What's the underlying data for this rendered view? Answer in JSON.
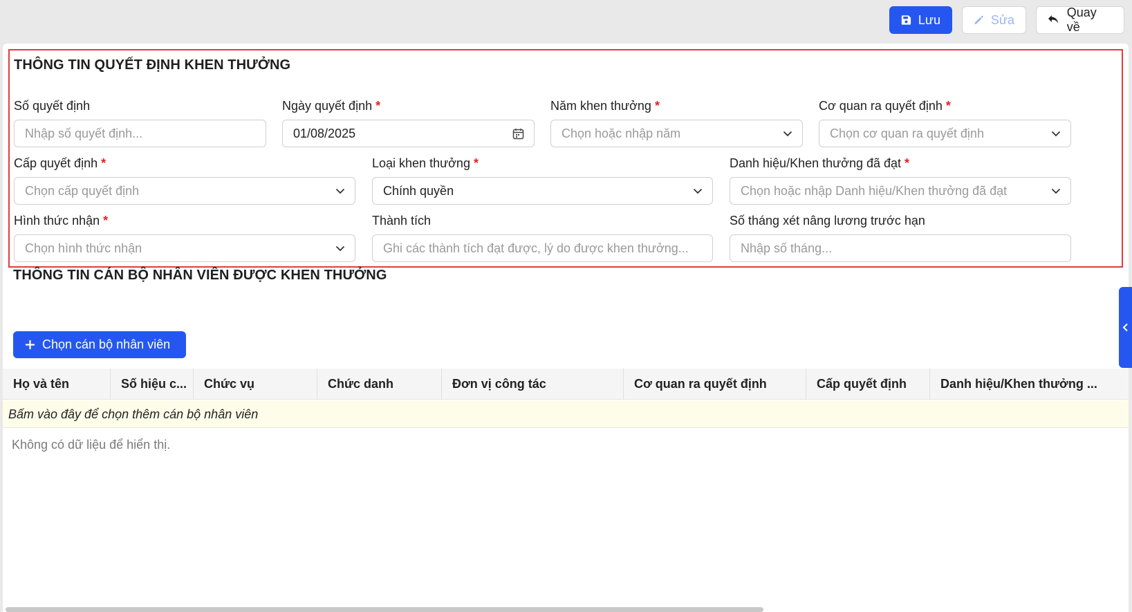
{
  "toolbar": {
    "save_label": "Lưu",
    "edit_label": "Sửa",
    "back_label": "Quay về"
  },
  "decision_section": {
    "title": "THÔNG TIN QUYẾT ĐỊNH KHEN THƯỞNG",
    "fields": {
      "so_quyet_dinh": {
        "label": "Số quyết định",
        "placeholder": "Nhập số quyết định..."
      },
      "ngay_quyet_dinh": {
        "label": "Ngày quyết định",
        "value": "01/08/2025"
      },
      "nam_khen_thuong": {
        "label": "Năm khen thưởng",
        "placeholder": "Chọn hoặc nhập năm"
      },
      "co_quan": {
        "label": "Cơ quan ra quyết định",
        "placeholder": "Chọn cơ quan ra quyết định"
      },
      "cap_quyet_dinh": {
        "label": "Cấp quyết định",
        "placeholder": "Chọn cấp quyết định"
      },
      "loai_khen_thuong": {
        "label": "Loại khen thưởng",
        "value": "Chính quyền"
      },
      "danh_hieu": {
        "label": "Danh hiệu/Khen thưởng đã đạt",
        "placeholder": "Chọn hoặc nhập Danh hiệu/Khen thưởng đã đạt"
      },
      "hinh_thuc_nhan": {
        "label": "Hình thức nhận",
        "placeholder": "Chọn hình thức nhận"
      },
      "thanh_tich": {
        "label": "Thành tích",
        "placeholder": "Ghi các thành tích đạt được, lý do được khen thưởng..."
      },
      "so_thang": {
        "label": "Số tháng xét nâng lương trước hạn",
        "placeholder": "Nhập số tháng..."
      }
    },
    "required_mark": "*"
  },
  "staff_section": {
    "title": "THÔNG TIN CÁN BỘ NHÂN VIÊN ĐƯỢC KHEN THƯỞNG",
    "add_button_label": "Chọn cán bộ nhân viên",
    "columns": [
      "Họ và tên",
      "Số hiệu c...",
      "Chức vụ",
      "Chức danh",
      "Đơn vị công tác",
      "Cơ quan ra quyết định",
      "Cấp quyết định",
      "Danh hiệu/Khen thưởng ..."
    ],
    "add_row_text": "Bấm vào đây để chọn thêm cán bộ nhân viên",
    "empty_text": "Không có dữ liệu để hiển thị."
  },
  "colors": {
    "primary": "#2557f0",
    "required": "#e02424",
    "section_border": "#e23b3b",
    "add_row_bg": "#fdfdea"
  }
}
